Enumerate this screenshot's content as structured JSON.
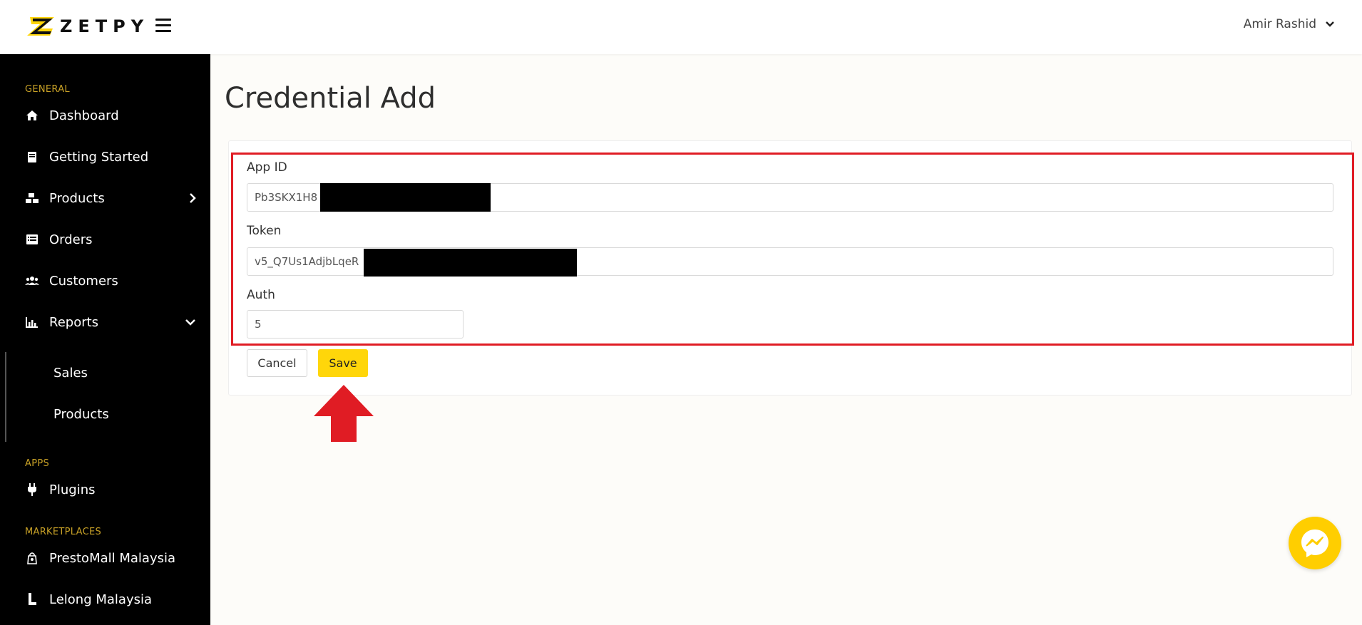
{
  "header": {
    "logo_text": "ZETPY",
    "user_name": "Amir Rashid"
  },
  "sidebar": {
    "sections": [
      {
        "label": "GENERAL",
        "items": [
          {
            "label": "Dashboard",
            "icon": "home-icon"
          },
          {
            "label": "Getting Started",
            "icon": "book-icon"
          },
          {
            "label": "Products",
            "icon": "boxes-icon",
            "chevron": "right"
          },
          {
            "label": "Orders",
            "icon": "list-icon"
          },
          {
            "label": "Customers",
            "icon": "users-icon"
          },
          {
            "label": "Reports",
            "icon": "chart-icon",
            "chevron": "down"
          }
        ],
        "subitems": [
          "Sales",
          "Products"
        ]
      },
      {
        "label": "APPS",
        "items": [
          {
            "label": "Plugins",
            "icon": "plug-icon"
          }
        ]
      },
      {
        "label": "MARKETPLACES",
        "items": [
          {
            "label": "PrestoMall Malaysia",
            "icon": "prestomall-icon"
          },
          {
            "label": "Lelong Malaysia",
            "icon": "lelong-icon"
          }
        ]
      }
    ]
  },
  "main": {
    "title": "Credential Add",
    "form": {
      "app_id": {
        "label": "App ID",
        "value": "Pb3SKX1H8"
      },
      "token": {
        "label": "Token",
        "value": "v5_Q7Us1AdjbLqeR"
      },
      "auth": {
        "label": "Auth",
        "value": "5"
      }
    },
    "buttons": {
      "cancel": "Cancel",
      "save": "Save"
    }
  },
  "colors": {
    "accent": "#ffd60a",
    "highlight": "#e01c24",
    "sidebar_bg": "#000000",
    "section_label": "#c9a227"
  }
}
